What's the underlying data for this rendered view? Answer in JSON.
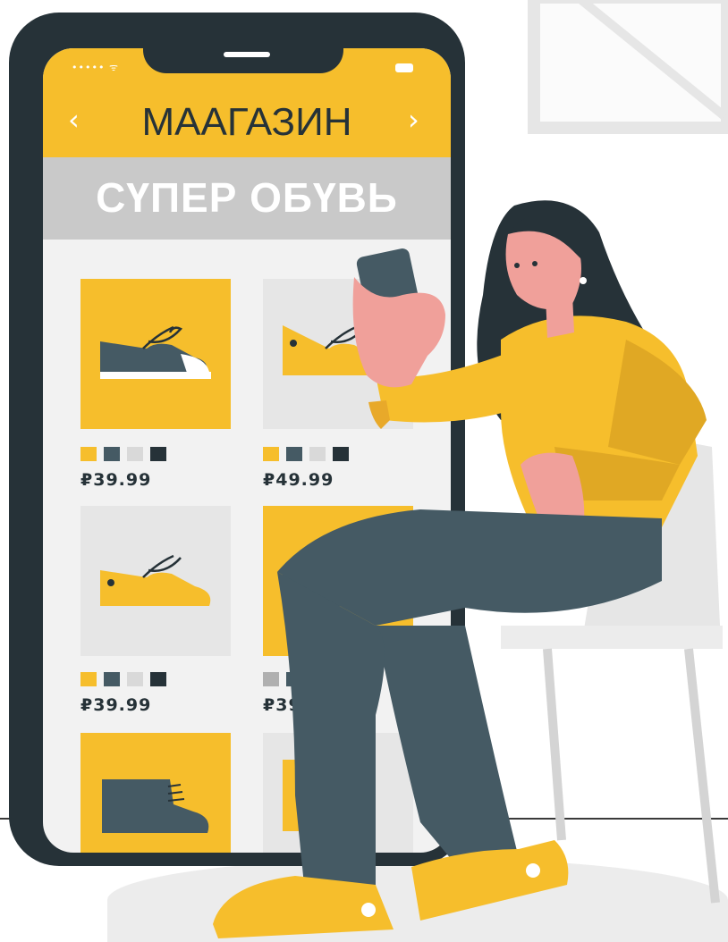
{
  "store": {
    "title": "МААГАЗИН",
    "banner": "СҮПЕР ОБҮВЬ",
    "nav_prev": "‹",
    "nav_next": "›",
    "status_signal": "••••• ᯤ"
  },
  "products": [
    {
      "price": "₽39.99",
      "swatches": [
        "#f6be2c",
        "#455a64",
        "#d9d9d9",
        "#263238"
      ]
    },
    {
      "price": "₽49.99",
      "swatches": [
        "#f6be2c",
        "#455a64",
        "#d9d9d9",
        "#263238"
      ]
    },
    {
      "price": "₽39.99",
      "swatches": [
        "#f6be2c",
        "#455a64",
        "#d9d9d9",
        "#263238"
      ]
    },
    {
      "price": "₽39.",
      "swatches": [
        "#b0b0b0",
        "#455a64"
      ]
    }
  ],
  "colors": {
    "accent": "#f6be2c",
    "dark": "#263238",
    "slate": "#455a64",
    "skin": "#f0a09a"
  }
}
